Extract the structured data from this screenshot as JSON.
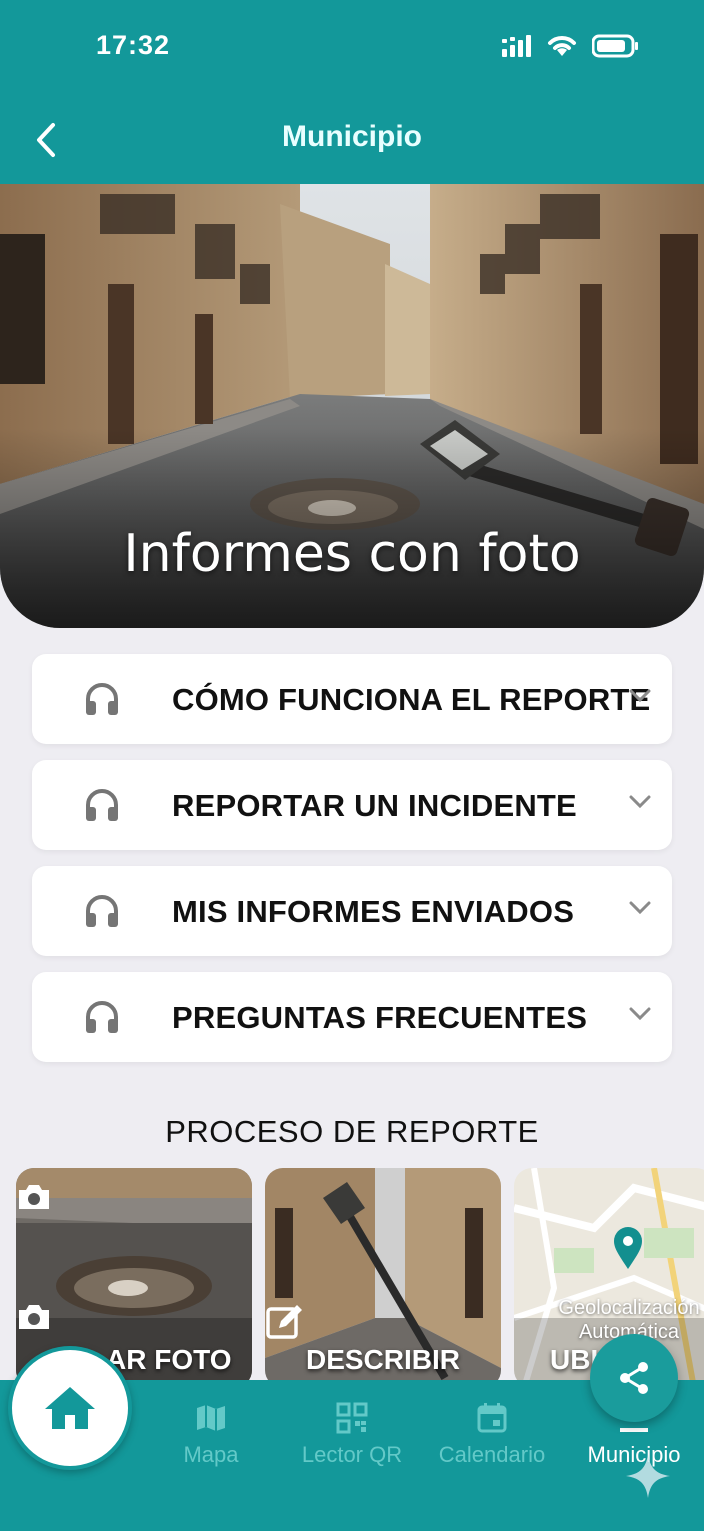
{
  "status_bar": {
    "time": "17:32",
    "icons": [
      "signal-icon",
      "wifi-icon",
      "battery-icon"
    ]
  },
  "header": {
    "title": "Municipio",
    "back_icon": "chevron-left-icon"
  },
  "hero": {
    "title": "Informes con foto"
  },
  "accordions": [
    {
      "label": "CÓMO FUNCIONA EL REPORTE",
      "icon": "headphones-icon"
    },
    {
      "label": "REPORTAR UN INCIDENTE",
      "icon": "headphones-icon"
    },
    {
      "label": "MIS INFORMES ENVIADOS",
      "icon": "headphones-icon"
    },
    {
      "label": "PREGUNTAS FRECUENTES",
      "icon": "headphones-icon"
    }
  ],
  "process": {
    "title": "PROCESO DE REPORTE",
    "cards": [
      {
        "label": "AR FOTO",
        "icon": "camera-icon"
      },
      {
        "label": "DESCRIBIR",
        "icon": "edit-icon"
      },
      {
        "label": "UBI  ÓN",
        "icon": "map-pin-icon",
        "caption_line1": "Geolocalización",
        "caption_line2": "Automática"
      }
    ]
  },
  "bottom_nav": {
    "items": [
      {
        "label": "Mapa",
        "icon": "map-icon"
      },
      {
        "label": "Lector QR",
        "icon": "qr-code-icon"
      },
      {
        "label": "Calendario",
        "icon": "calendar-icon"
      },
      {
        "label": "Municipio",
        "icon": "building-icon",
        "active": true
      }
    ],
    "home_icon": "home-icon"
  },
  "share_icon": "share-icon",
  "colors": {
    "primary": "#13989a",
    "nav_inactive": "#63c9c8",
    "background": "#eeedf2"
  }
}
